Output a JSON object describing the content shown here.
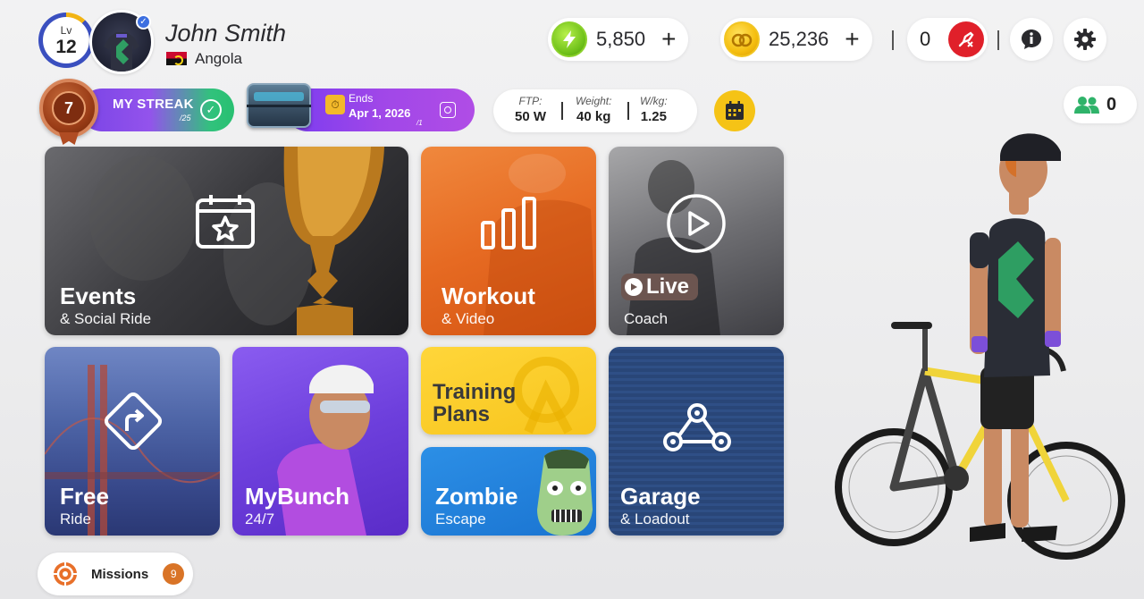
{
  "profile": {
    "level_prefix": "Lv",
    "level": "12",
    "name": "John Smith",
    "country": "Angola"
  },
  "currencies": [
    {
      "name": "energy",
      "amount": "5,850",
      "plus": "+",
      "icon": "lightning-icon",
      "color": "#6fc11a"
    },
    {
      "name": "coins",
      "amount": "25,236",
      "plus": "+",
      "icon": "coin-icon",
      "color": "#f5be10"
    }
  ],
  "connections": {
    "count": "0",
    "icon": "strava-disconnected-icon",
    "color": "#e0202a"
  },
  "header_buttons": {
    "info_icon": "info-icon",
    "settings_icon": "gear-icon"
  },
  "streak": {
    "value": "7",
    "label": "MY STREAK",
    "sub": "/25"
  },
  "event_timer": {
    "ends_label": "Ends",
    "ends_date": "Apr 1, 2026",
    "sub": "/1"
  },
  "stats": [
    {
      "label": "FTP:",
      "value": "50 W"
    },
    {
      "label": "Weight:",
      "value": "40 kg"
    },
    {
      "label": "W/kg:",
      "value": "1.25"
    }
  ],
  "calendar": {
    "icon": "calendar-icon",
    "color": "#f5c316"
  },
  "friends": {
    "count": "0",
    "icon": "friends-icon",
    "color": "#2fb36a"
  },
  "tiles": {
    "events": {
      "title": "Events",
      "sub": "& Social Ride"
    },
    "workout": {
      "title": "Workout",
      "sub": "& Video"
    },
    "live": {
      "title": "Live",
      "sub": "Coach"
    },
    "free": {
      "title": "Free",
      "sub": "Ride"
    },
    "mybunch": {
      "title": "MyBunch",
      "sub": "24/7"
    },
    "training": {
      "title_line1": "Training",
      "title_line2": "Plans"
    },
    "zombie": {
      "title": "Zombie",
      "sub": "Escape"
    },
    "garage": {
      "title": "Garage",
      "sub": "& Loadout"
    }
  },
  "missions": {
    "label": "Missions",
    "count": "9"
  }
}
